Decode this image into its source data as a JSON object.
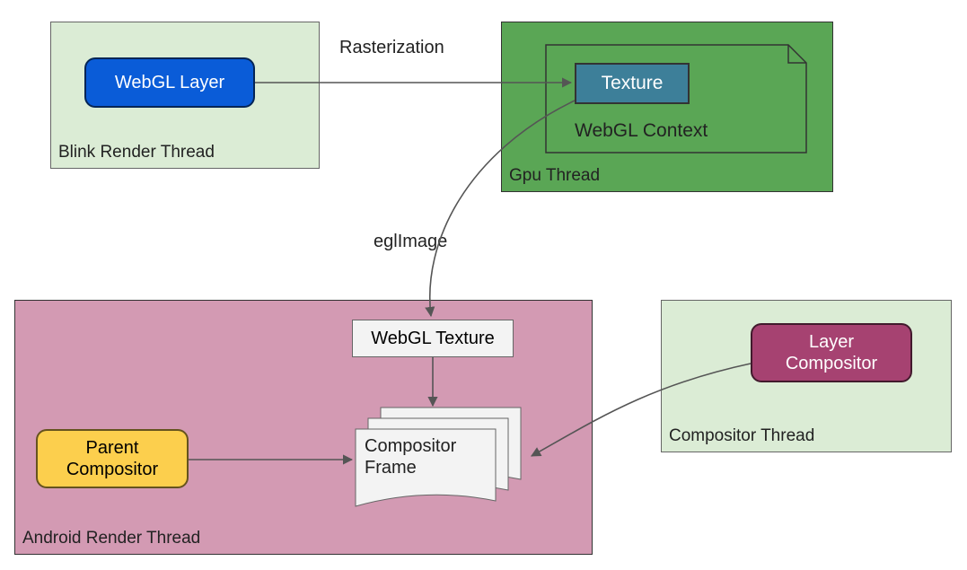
{
  "threads": {
    "blink": {
      "label": "Blink Render Thread"
    },
    "gpu": {
      "label": "Gpu Thread"
    },
    "android": {
      "label": "Android Render Thread"
    },
    "compositor": {
      "label": "Compositor Thread"
    }
  },
  "nodes": {
    "webgl_layer": "WebGL Layer",
    "texture": "Texture",
    "webgl_context": "WebGL Context",
    "webgl_texture": "WebGL Texture",
    "parent_compositor": "Parent Compositor",
    "compositor_frame_l1": "Compositor",
    "compositor_frame_l2": "Frame",
    "layer_compositor_l1": "Layer",
    "layer_compositor_l2": "Compositor"
  },
  "edges": {
    "rasterization": "Rasterization",
    "eglimage": "eglImage"
  }
}
